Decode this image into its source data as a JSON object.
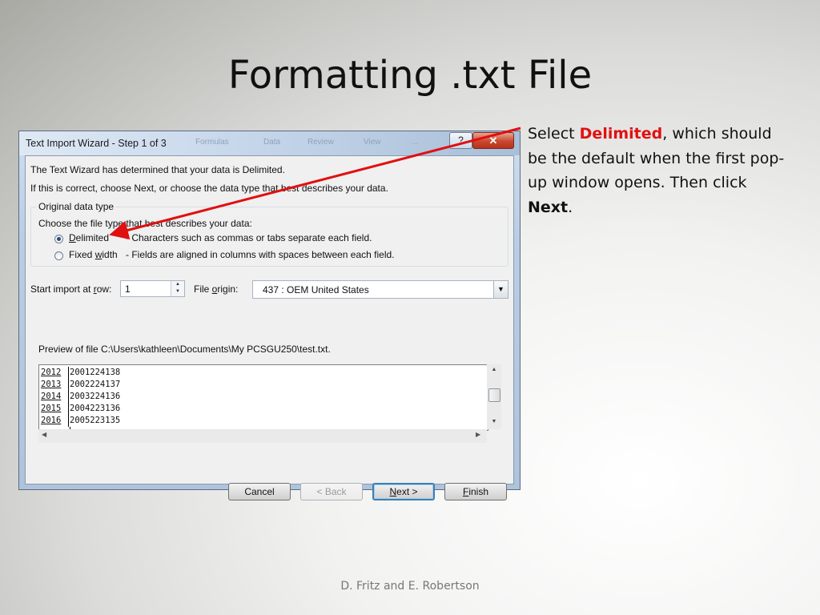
{
  "slide": {
    "title": "Formatting .txt File",
    "caption": {
      "pre": "Select ",
      "highlight": "Delimited",
      "mid": ", which should be the default when the first pop-up window opens.  Then click ",
      "bold": "Next",
      "post": "."
    },
    "footer": "D. Fritz and E. Robertson",
    "arrow_color": "#e01010"
  },
  "dialog": {
    "title": "Text Import Wizard - Step 1 of 3",
    "help_label": "?",
    "close_label": "✕",
    "background_tabs": [
      "Formulas",
      "Data",
      "Review",
      "View",
      "..."
    ],
    "intro_line1": "The Text Wizard has determined that your data is Delimited.",
    "intro_line2": "If this is correct, choose Next, or choose the data type that best describes your data.",
    "group_label": "Original data type",
    "group_prompt": "Choose the file type that best describes your data:",
    "options": [
      {
        "label": "Delimited",
        "desc": "- Characters such as commas or tabs separate each field.",
        "selected": true
      },
      {
        "label": "Fixed width",
        "desc": "- Fields are aligned in columns with spaces between each field.",
        "selected": false
      }
    ],
    "start_row_label": "Start import at row:",
    "start_row_value": "1",
    "file_origin_label": "File origin:",
    "file_origin_value": "437 : OEM United States",
    "preview_label": "Preview of file C:\\Users\\kathleen\\Documents\\My PCSGU250\\test.txt.",
    "preview_rows": [
      {
        "col1": "2012",
        "rest": "2001224138"
      },
      {
        "col1": "2013",
        "rest": "2002224137"
      },
      {
        "col1": "2014",
        "rest": "2003224136"
      },
      {
        "col1": "2015",
        "rest": "2004223136"
      },
      {
        "col1": "2016",
        "rest": "2005223135"
      }
    ],
    "buttons": {
      "cancel": "Cancel",
      "back": "< Back",
      "next": "Next >",
      "finish": "Finish"
    }
  }
}
